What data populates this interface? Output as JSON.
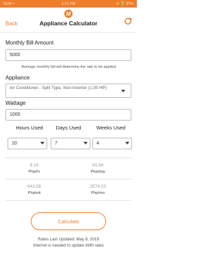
{
  "status_bar": {
    "left": "SUN ≈",
    "time": "1:21 PM",
    "right": "⊙ 🔋 97%"
  },
  "header": {
    "back_label": "Back",
    "title": "Appliance Calculator",
    "logo_letter": "M"
  },
  "bill": {
    "label": "Monthly Bill Amount",
    "value": "5000",
    "hint": "Average monthly bill will determine the rate to be applied."
  },
  "appliance": {
    "label": "Appliance",
    "selected": "Air Conditioner - Split Type, Non-Inverter (1.00 HP)"
  },
  "wattage": {
    "label": "Wattage",
    "value": "1000"
  },
  "usage": {
    "hours_label": "Hours Used",
    "hours_value": "10",
    "days_label": "Days Used",
    "days_value": "7",
    "weeks_label": "Weeks Used",
    "weeks_value": "4"
  },
  "results": {
    "per_hour": {
      "value": "9.19",
      "unit": "Php/hr"
    },
    "per_day": {
      "value": "91.94",
      "unit": "Php/day"
    },
    "per_week": {
      "value": "643.56",
      "unit": "Php/wk"
    },
    "per_month": {
      "value": "2574.23",
      "unit": "Php/mo"
    }
  },
  "calculate_label": "Calculate",
  "footer": {
    "rates_updated": "Rates Last Updated: May 8, 2019",
    "internet_note": "Internet is needed to update kWh rates"
  },
  "colors": {
    "accent": "#ef7d2a"
  }
}
